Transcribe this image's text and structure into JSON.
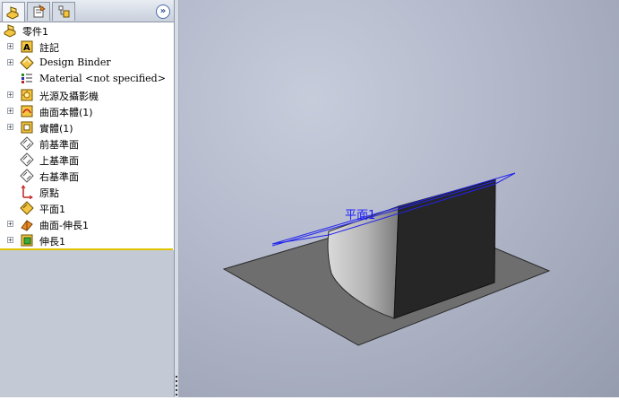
{
  "feature_manager": {
    "tabs": [
      {
        "name": "feature-manager-tree",
        "icon": "part-icon",
        "active": true
      },
      {
        "name": "property-manager",
        "icon": "property-icon",
        "active": false
      },
      {
        "name": "configuration-manager",
        "icon": "configuration-icon",
        "active": false
      }
    ],
    "collapse_glyph": "»",
    "root": {
      "label": "零件1",
      "icon": "part-icon"
    },
    "items": [
      {
        "label": "註記",
        "icon": "annotations-icon",
        "expandable": true,
        "serif": false
      },
      {
        "label": "Design Binder",
        "icon": "design-binder-icon",
        "expandable": true,
        "serif": true
      },
      {
        "label": "Material <not specified>",
        "icon": "material-icon",
        "expandable": false,
        "serif": true
      },
      {
        "label": "光源及攝影機",
        "icon": "lights-cameras-icon",
        "expandable": true,
        "serif": false
      },
      {
        "label": "曲面本體(1)",
        "icon": "surface-bodies-icon",
        "expandable": true,
        "serif": false
      },
      {
        "label": "實體(1)",
        "icon": "solid-bodies-icon",
        "expandable": true,
        "serif": false
      },
      {
        "label": "前基準面",
        "icon": "plane-icon",
        "expandable": false,
        "serif": false
      },
      {
        "label": "上基準面",
        "icon": "plane-icon",
        "expandable": false,
        "serif": false
      },
      {
        "label": "右基準面",
        "icon": "plane-icon",
        "expandable": false,
        "serif": false
      },
      {
        "label": "原點",
        "icon": "origin-icon",
        "expandable": false,
        "serif": false
      },
      {
        "label": "平面1",
        "icon": "plane1-icon",
        "expandable": false,
        "serif": false
      },
      {
        "label": "曲面-伸長1",
        "icon": "surface-extrude-icon",
        "expandable": true,
        "serif": false
      },
      {
        "label": "伸長1",
        "icon": "extrude-icon",
        "expandable": true,
        "serif": false
      }
    ]
  },
  "viewport": {
    "plane_label": "平面1",
    "plane_label_color": "#1a1aff",
    "colors": {
      "base_surface": "#6e6e6e",
      "dark_face": "#262626",
      "curved_face_light": "#d8d8d8",
      "curved_face_dark": "#7a7a7a",
      "plane_outline": "#2222ee"
    }
  }
}
